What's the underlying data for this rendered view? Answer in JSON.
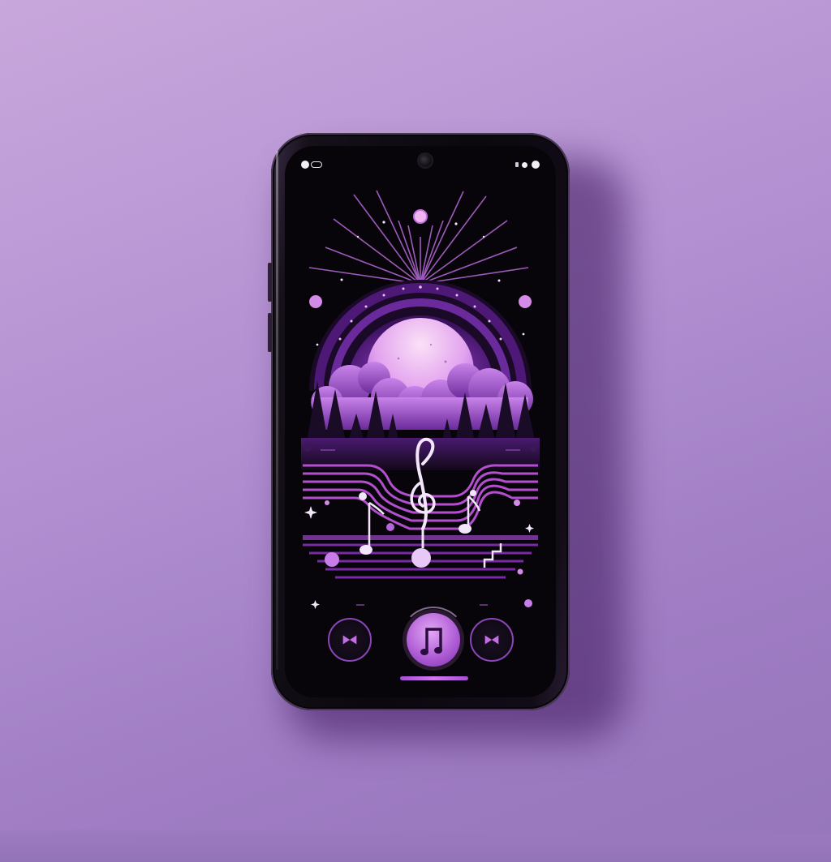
{
  "page": {
    "background_color": "#b391d2",
    "accent_color": "#c46ee6",
    "phone_body_color": "#0b080f"
  },
  "status_bar": {
    "left_icons": [
      "status-dot-icon",
      "link-pill-icon"
    ],
    "right_icons": [
      "signal-tick-icon",
      "wifi-dot-icon",
      "battery-dot-icon"
    ],
    "camera": "front-camera-icon"
  },
  "artwork": {
    "description_icons": [
      "sunburst-icon",
      "moon-icon",
      "pine-trees-icon",
      "clouds-icon",
      "treble-clef-icon",
      "music-note-icon",
      "music-staff-icon"
    ],
    "colors": {
      "moon_top": "#f7c8f2",
      "moon_bottom": "#b56ee0",
      "dome": "#5a1f86",
      "trees": "#1a0b26",
      "staff": "#b34fcf",
      "notes": "#f3e6fb"
    }
  },
  "player_controls": {
    "previous_icon": "skip-previous-icon",
    "play_icon": "music-note-icon",
    "next_icon": "skip-next-icon"
  }
}
